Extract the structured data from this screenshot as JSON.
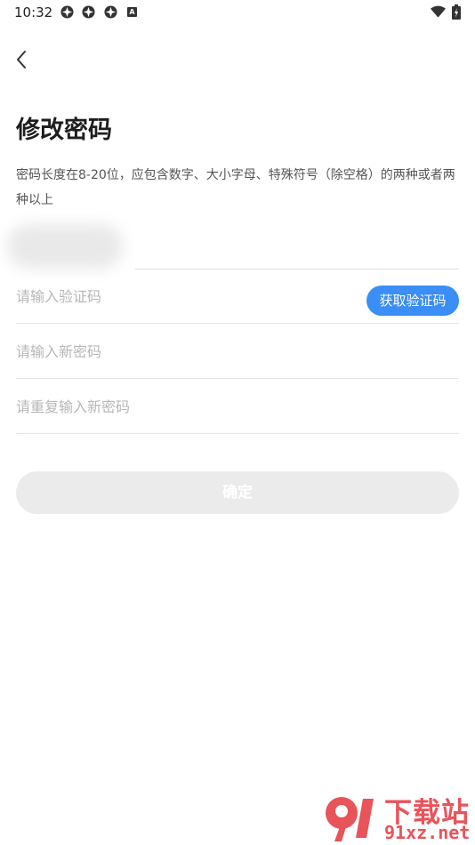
{
  "status_bar": {
    "time": "10:32",
    "notification_badge": "A"
  },
  "page": {
    "title": "修改密码",
    "hint": "密码长度在8-20位，应包含数字、大小字母、特殊符号（除空格）的两种或者两种以上"
  },
  "form": {
    "code_placeholder": "请输入验证码",
    "get_code_label": "获取验证码",
    "new_password_placeholder": "请输入新密码",
    "repeat_password_placeholder": "请重复输入新密码",
    "confirm_label": "确定"
  },
  "colors": {
    "accent": "#3a8ef6",
    "disabled_button": "#ebebeb",
    "watermark": "#e9535a"
  },
  "watermark": {
    "text_cn": "下载站",
    "text_en": "91xz.net"
  }
}
